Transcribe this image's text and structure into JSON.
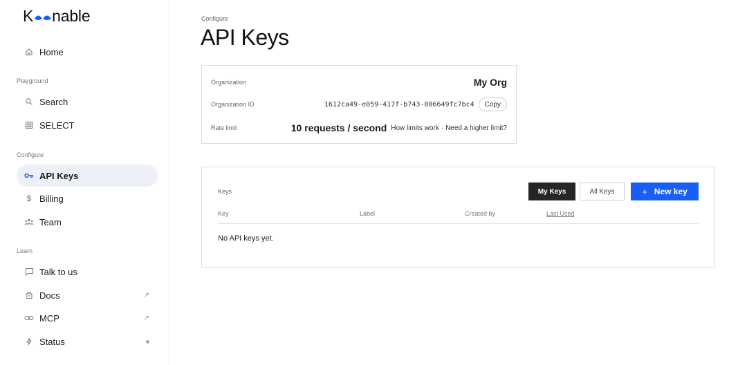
{
  "brand": {
    "logo_prefix": "K",
    "logo_suffix": "nable",
    "accent": "#1a5ff5"
  },
  "sidebar": {
    "home": {
      "label": "Home",
      "icon": "home-icon"
    },
    "sections": {
      "playground": "Playground",
      "configure": "Configure",
      "learn": "Learn"
    },
    "playground_items": [
      {
        "label": "Search",
        "icon": "search-icon"
      },
      {
        "label": "SELECT",
        "icon": "table-icon"
      }
    ],
    "configure_items": [
      {
        "label": "API Keys",
        "icon": "key-icon",
        "active": true
      },
      {
        "label": "Billing",
        "icon": "dollar-icon"
      },
      {
        "label": "Team",
        "icon": "team-icon"
      }
    ],
    "learn_items": [
      {
        "label": "Talk to us",
        "icon": "chat-icon"
      },
      {
        "label": "Docs",
        "icon": "docs-icon",
        "external": "↗"
      },
      {
        "label": "MCP",
        "icon": "link-icon",
        "external": "↗"
      },
      {
        "label": "Status",
        "icon": "bolt-icon"
      }
    ]
  },
  "main": {
    "breadcrumb": "Configure",
    "title": "API Keys",
    "org_card": {
      "org_label": "Organization",
      "org_name": "My Org",
      "org_id_label": "Organization ID",
      "org_id": "1612ca49-e059-417f-b743-006649fc7bc4",
      "copy_label": "Copy",
      "rate_label": "Rate limit",
      "rate_value": "10 requests / second",
      "rate_link_1": "How limits work",
      "rate_sep": "·",
      "rate_link_2": "Need a higher limit?"
    },
    "keys_card": {
      "label": "Keys",
      "my_keys": "My Keys",
      "all_keys": "All Keys",
      "new_key_plus": "+",
      "new_key": "New key",
      "columns": [
        "Key",
        "Label",
        "Created by",
        "Last Used"
      ],
      "empty": "No API keys yet."
    }
  }
}
